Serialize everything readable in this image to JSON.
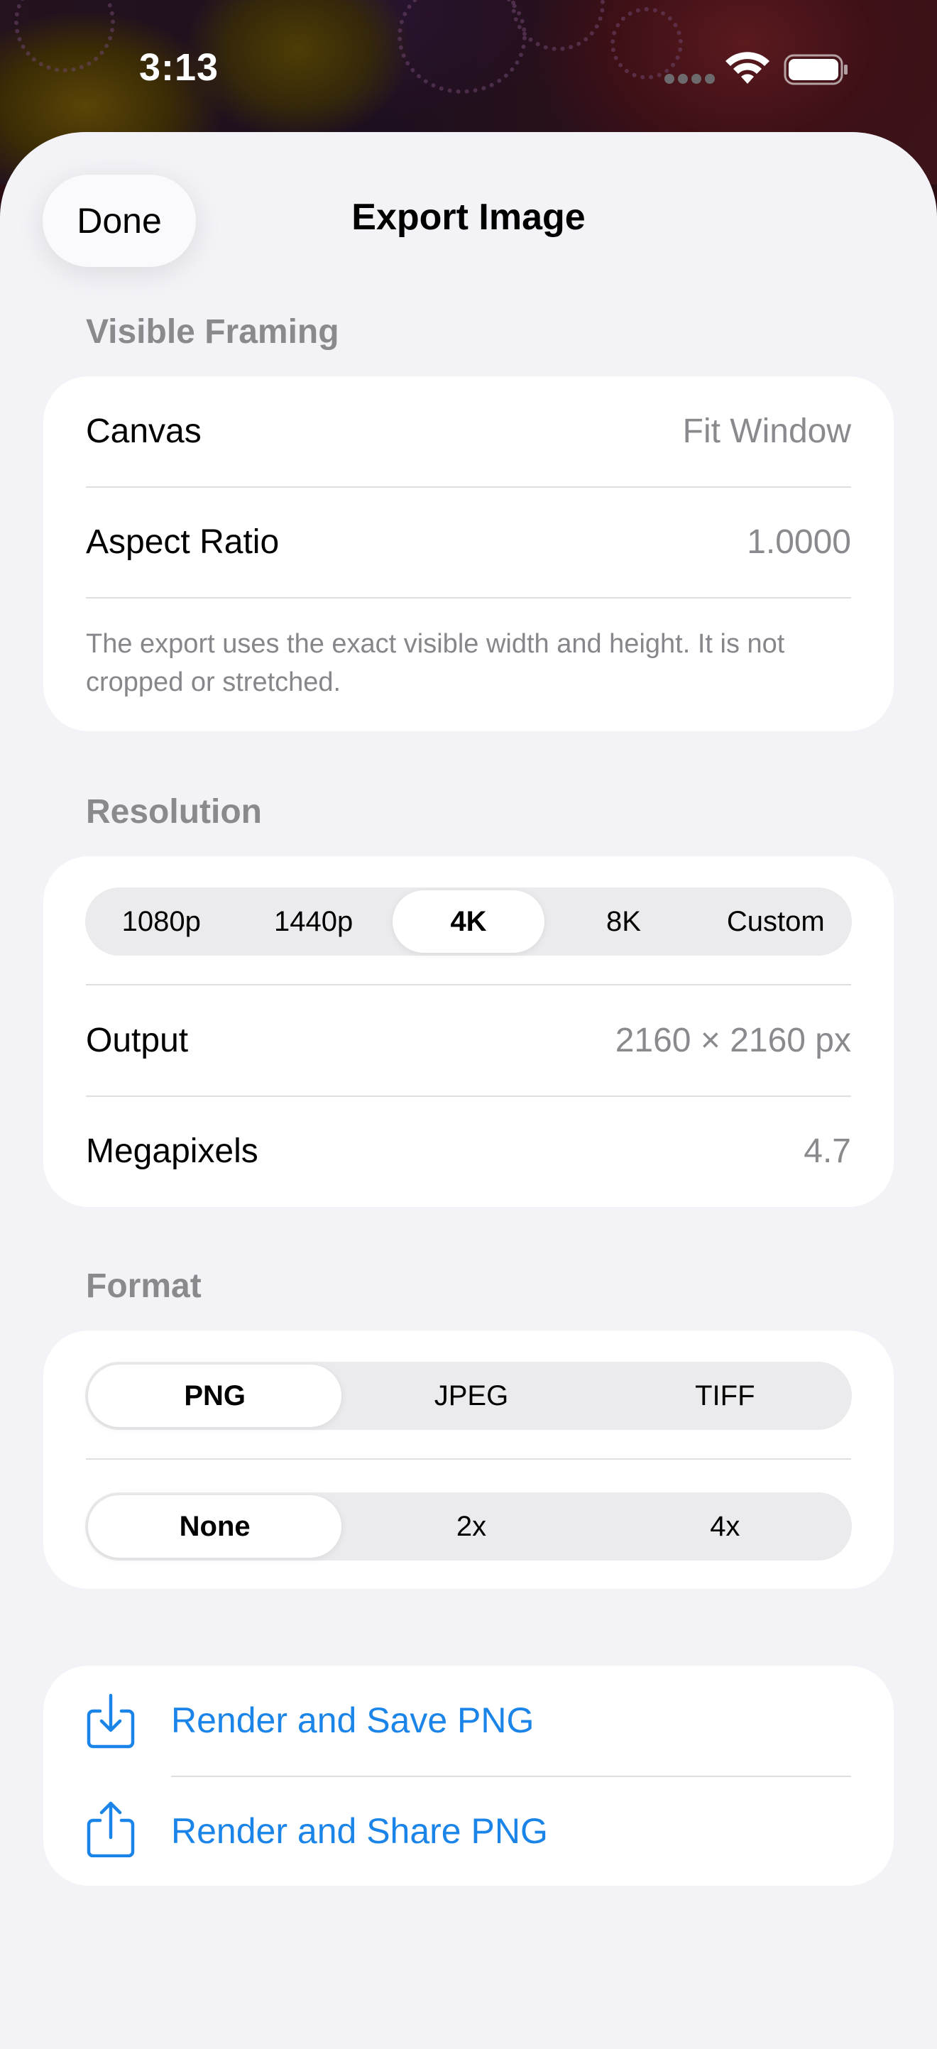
{
  "status_bar": {
    "time": "3:13",
    "wifi_icon": "wifi-icon",
    "battery_icon": "battery-icon"
  },
  "header": {
    "done_label": "Done",
    "title": "Export Image"
  },
  "visible_framing": {
    "header": "Visible Framing",
    "rows": [
      {
        "label": "Canvas",
        "value": "Fit Window"
      },
      {
        "label": "Aspect Ratio",
        "value": "1.0000"
      }
    ],
    "footnote": "The export uses the exact visible width and height. It is not cropped or stretched."
  },
  "resolution": {
    "header": "Resolution",
    "options": [
      "1080p",
      "1440p",
      "4K",
      "8K",
      "Custom"
    ],
    "selected": "4K",
    "rows": [
      {
        "label": "Output",
        "value": "2160 × 2160 px"
      },
      {
        "label": "Megapixels",
        "value": "4.7"
      }
    ]
  },
  "format": {
    "header": "Format",
    "format_options": [
      "PNG",
      "JPEG",
      "TIFF"
    ],
    "format_selected": "PNG",
    "upscale_options": [
      "None",
      "2x",
      "4x"
    ],
    "upscale_selected": "None"
  },
  "actions": {
    "save_label": "Render and Save PNG",
    "save_icon": "download-tray-icon",
    "share_label": "Render and Share PNG",
    "share_icon": "share-icon"
  },
  "colors": {
    "accent": "#1a84e8",
    "sheet_background": "#f2f2f7",
    "secondary_text": "#8a8a8e"
  }
}
